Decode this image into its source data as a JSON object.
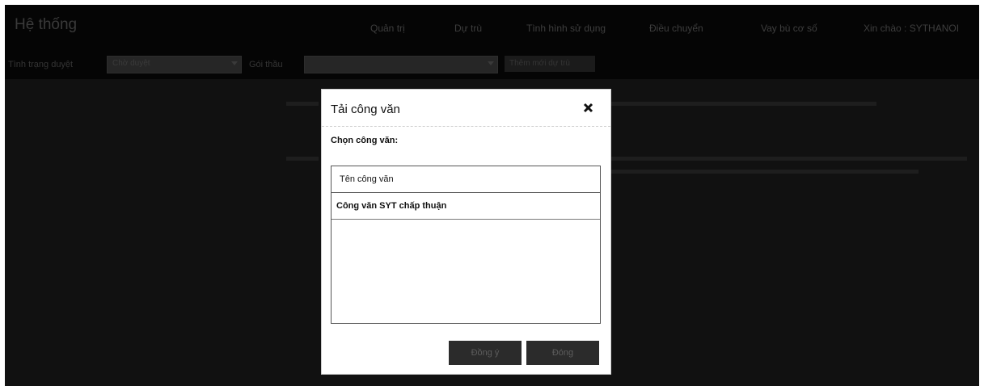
{
  "header": {
    "app_title": "Hệ thống",
    "nav": [
      "Quản trị",
      "Dự trù",
      "Tình hình sử dụng",
      "Điều chuyển",
      "Vay bù cơ số",
      "Xin chào : SYTHANOI"
    ]
  },
  "filters": {
    "status_label": "Tình trạng duyệt",
    "status_value": "Chờ duyệt",
    "package_label": "Gói thầu",
    "package_value": "",
    "action_label": "Thêm mới dự trù"
  },
  "modal": {
    "title": "Tải công văn",
    "field_label": "Chọn công văn:",
    "table": {
      "column_header": "Tên công văn",
      "rows": [
        "Công văn SYT chấp thuận"
      ]
    },
    "buttons": {
      "ok": "Đồng ý",
      "close": "Đóng"
    }
  },
  "colors": {
    "overlay": "#0c0c0c",
    "modal_bg": "#ffffff",
    "button_bg": "#2b2b2b"
  }
}
